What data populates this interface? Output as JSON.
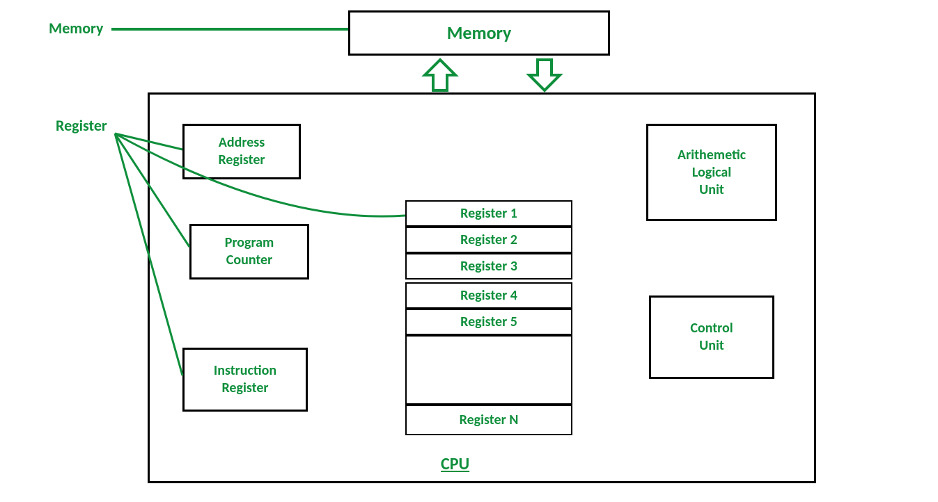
{
  "labels": {
    "memoryExternal": "Memory",
    "memoryBox": "Memory",
    "registerExternal": "Register",
    "cpu": "CPU"
  },
  "leftBoxes": {
    "address": "Address\nRegister",
    "pc": "Program\nCounter",
    "ir": "Instruction\nRegister"
  },
  "rightBoxes": {
    "alu": "Arithemetic\nLogical\nUnit",
    "cu": "Control\nUnit"
  },
  "registers": {
    "r1": "Register 1",
    "r2": "Register 2",
    "r3": "Register 3",
    "r4": "Register 4",
    "r5": "Register 5",
    "rN": "Register N"
  },
  "colors": {
    "accent": "#0f8f3c",
    "border": "#000000"
  }
}
